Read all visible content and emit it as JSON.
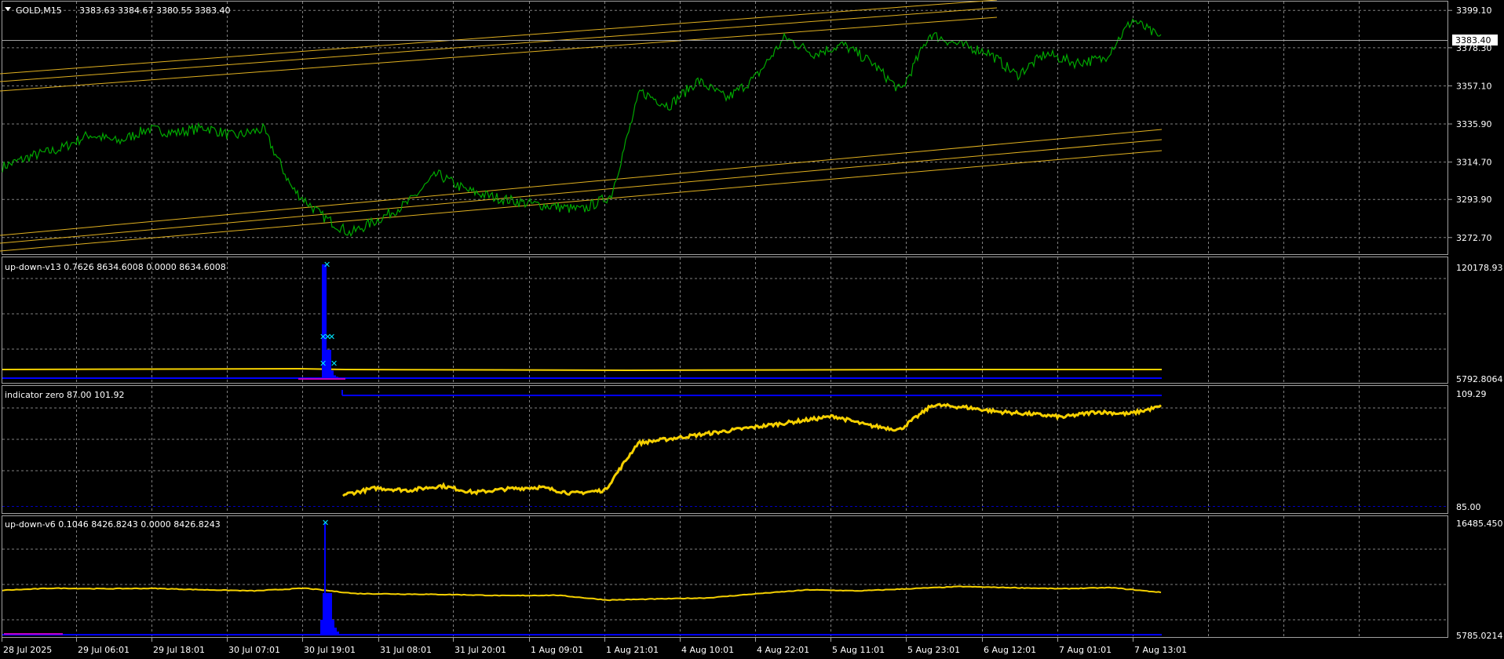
{
  "main": {
    "symbol": "GOLD,M15",
    "ohlc": "3383.63 3384.67 3380.55 3383.40",
    "current_price": "3383.40",
    "y_labels": [
      "3399.10",
      "3378.30",
      "3357.10",
      "3335.90",
      "3314.70",
      "3293.90",
      "3272.70"
    ],
    "ylim": [
      3263,
      3404
    ]
  },
  "pane1": {
    "label": "up-down-v13 0.7626 8634.6008 0.0000 8634.6008",
    "y_top": "120178.93",
    "y_bottom": "5792.8064"
  },
  "pane2": {
    "label": "indicator zero 87.00 101.92",
    "y_top": "109.29",
    "y_bottom": "85.00"
  },
  "pane3": {
    "label": "up-down-v6 0.1046 8426.8243 0.0000 8426.8243",
    "y_top": "16485.450",
    "y_bottom": "5785.0214"
  },
  "x_labels": [
    "28 Jul 2025",
    "29 Jul 06:01",
    "29 Jul 18:01",
    "30 Jul 07:01",
    "30 Jul 19:01",
    "31 Jul 08:01",
    "31 Jul 20:01",
    "1 Aug 09:01",
    "1 Aug 21:01",
    "4 Aug 10:01",
    "4 Aug 22:01",
    "5 Aug 11:01",
    "5 Aug 23:01",
    "6 Aug 12:01",
    "7 Aug 01:01",
    "7 Aug 13:01"
  ],
  "colors": {
    "price": "#00a800",
    "channel": "#e0b020",
    "indicator_yellow": "#f5d000",
    "histogram_blue": "#0000ff",
    "marker_cyan": "#00e5ff",
    "grid": "#808080"
  },
  "chart_data": [
    {
      "type": "line",
      "title": "GOLD,M15",
      "series": [
        {
          "name": "GOLD,M15",
          "values": [
            3312,
            3318,
            3322,
            3330,
            3326,
            3333,
            3331,
            3334,
            3329,
            3333,
            3300,
            3285,
            3275,
            3283,
            3292,
            3308,
            3299,
            3295,
            3292,
            3290,
            3288,
            3296,
            3354,
            3346,
            3360,
            3350,
            3362,
            3384,
            3375,
            3380,
            3370,
            3354,
            3386,
            3380,
            3376,
            3363,
            3375,
            3370,
            3372,
            3394,
            3383
          ]
        }
      ],
      "ylim": [
        3263,
        3404
      ]
    },
    {
      "type": "bar",
      "title": "up-down-v13",
      "series": [
        {
          "name": "histogram",
          "values": [
            0,
            0,
            0,
            120178,
            30000,
            8000,
            0,
            0,
            0,
            0
          ]
        }
      ],
      "ylim": [
        5792.8064,
        120178.93
      ]
    },
    {
      "type": "line",
      "title": "indicator zero",
      "series": [
        {
          "name": "zero",
          "values": [
            87.5,
            89,
            88.5,
            89.5,
            88,
            88.8,
            89.2,
            87.8,
            88.5,
            99,
            100,
            101,
            102,
            103,
            104,
            105,
            103,
            102,
            107.5,
            107,
            106,
            105.5,
            104.8,
            106,
            105.5,
            107.2
          ]
        }
      ],
      "ylim": [
        85.0,
        109.29
      ]
    },
    {
      "type": "line",
      "title": "up-down-v6",
      "series": [
        {
          "name": "v6",
          "values": [
            9900,
            10100,
            10050,
            10080,
            9950,
            9850,
            10100,
            9600,
            9550,
            9500,
            9400,
            9450,
            9000,
            9100,
            9200,
            9600,
            9950,
            9850,
            10050,
            10250,
            10150,
            10050,
            10150,
            9700
          ]
        }
      ],
      "ylim": [
        5785.0214,
        16485.45
      ]
    }
  ]
}
